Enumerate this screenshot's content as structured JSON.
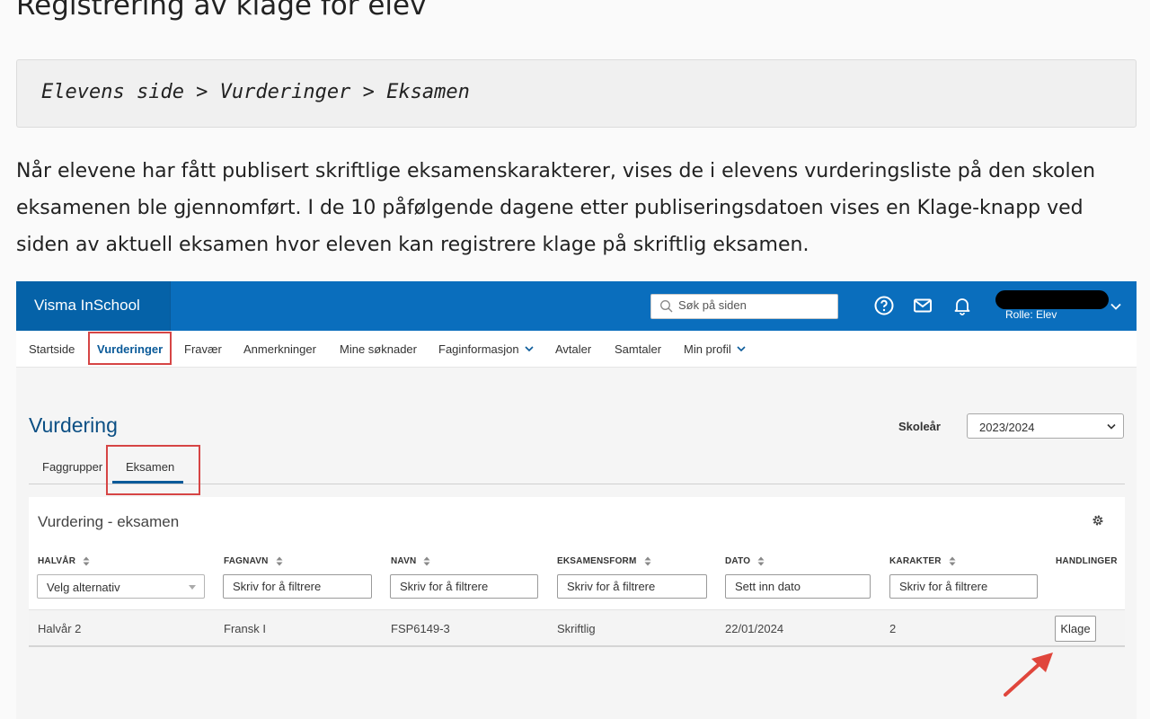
{
  "doc": {
    "title": "Registrering av klage for elev",
    "path": "Elevens side > Vurderinger > Eksamen",
    "paragraph": "Når elevene har fått publisert skriftlige eksamenskarakterer, vises de i elevens vurderingsliste på den skolen eksamenen ble gjennomført. I de 10 påfølgende dagene etter publiseringsdatoen vises en Klage-knapp ved siden av aktuell eksamen hvor eleven kan registrere klage på skriftlig eksamen."
  },
  "app": {
    "brand": "Visma InSchool",
    "search_placeholder": "Søk på siden",
    "role": "Rolle: Elev",
    "icons": [
      "search-icon",
      "help-icon",
      "mail-icon",
      "bell-icon",
      "chevron-down-icon",
      "gear-icon",
      "sort-icon"
    ],
    "accent": "#0a6ebd",
    "highlight": "#d64545"
  },
  "nav": {
    "items": [
      {
        "label": "Startside"
      },
      {
        "label": "Vurderinger"
      },
      {
        "label": "Fravær"
      },
      {
        "label": "Anmerkninger"
      },
      {
        "label": "Mine søknader"
      },
      {
        "label": "Faginformasjon"
      },
      {
        "label": "Avtaler"
      },
      {
        "label": "Samtaler"
      },
      {
        "label": "Min profil"
      }
    ],
    "active": "Vurderinger"
  },
  "page": {
    "title": "Vurdering",
    "year_label": "Skoleår",
    "year_value": "2023/2024",
    "tabs": [
      {
        "label": "Faggrupper"
      },
      {
        "label": "Eksamen"
      }
    ],
    "active_tab": "Eksamen"
  },
  "table": {
    "title": "Vurdering - eksamen",
    "columns": [
      "HALVÅR",
      "FAGNAVN",
      "NAVN",
      "EKSAMENSFORM",
      "DATO",
      "KARAKTER",
      "HANDLINGER"
    ],
    "filters": {
      "halvar": "Velg alternativ",
      "text_placeholder": "Skriv for å filtrere",
      "date_placeholder": "Sett inn dato"
    },
    "rows": [
      {
        "halvar": "Halvår 2",
        "fagnavn": "Fransk I",
        "navn": "FSP6149-3",
        "eksamensform": "Skriftlig",
        "dato": "22/01/2024",
        "karakter": "2",
        "action": "Klage"
      }
    ]
  }
}
